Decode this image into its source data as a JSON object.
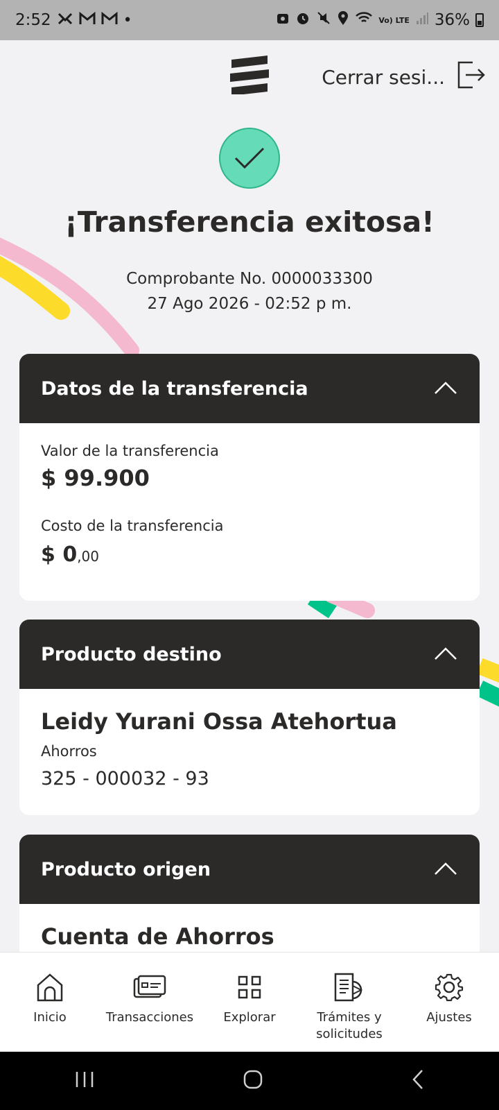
{
  "status_bar": {
    "time": "2:52",
    "left_icons": [
      "notification-icon",
      "gmail-icon",
      "gmail-icon",
      "dot-icon"
    ],
    "battery": "36%",
    "lte": "Vo) LTE"
  },
  "header": {
    "logout_label": "Cerrar sesi..."
  },
  "success": {
    "title": "¡Transferencia exitosa!",
    "receipt": "Comprobante No. 0000033300",
    "datetime": "27 Ago 2026 - 02:52 p m."
  },
  "transfer_card": {
    "title": "Datos de la transferencia",
    "value_label": "Valor de la transferencia",
    "value": "$ 99.900",
    "cost_label": "Costo de la transferencia",
    "cost_main": "$ 0",
    "cost_decimals": ",00"
  },
  "destination_card": {
    "title": "Producto destino",
    "name": "Leidy Yurani Ossa Atehortua",
    "account_type": "Ahorros",
    "account_number": "325 - 000032 - 93"
  },
  "origin_card": {
    "title": "Producto origen",
    "name": "Cuenta de Ahorros"
  },
  "bottom_nav": [
    {
      "label": "Inicio",
      "icon": "home-icon"
    },
    {
      "label": "Transacciones",
      "icon": "card-icon"
    },
    {
      "label": "Explorar",
      "icon": "grid-icon"
    },
    {
      "label": "Trámites y\nsolicitudes",
      "icon": "document-icon"
    },
    {
      "label": "Ajustes",
      "icon": "gear-icon"
    }
  ],
  "colors": {
    "dark": "#2c2a29",
    "success_green": "#66dbb8",
    "stripe_pink": "#f4b8cf",
    "stripe_yellow": "#fddb2a",
    "stripe_green": "#00c389"
  }
}
